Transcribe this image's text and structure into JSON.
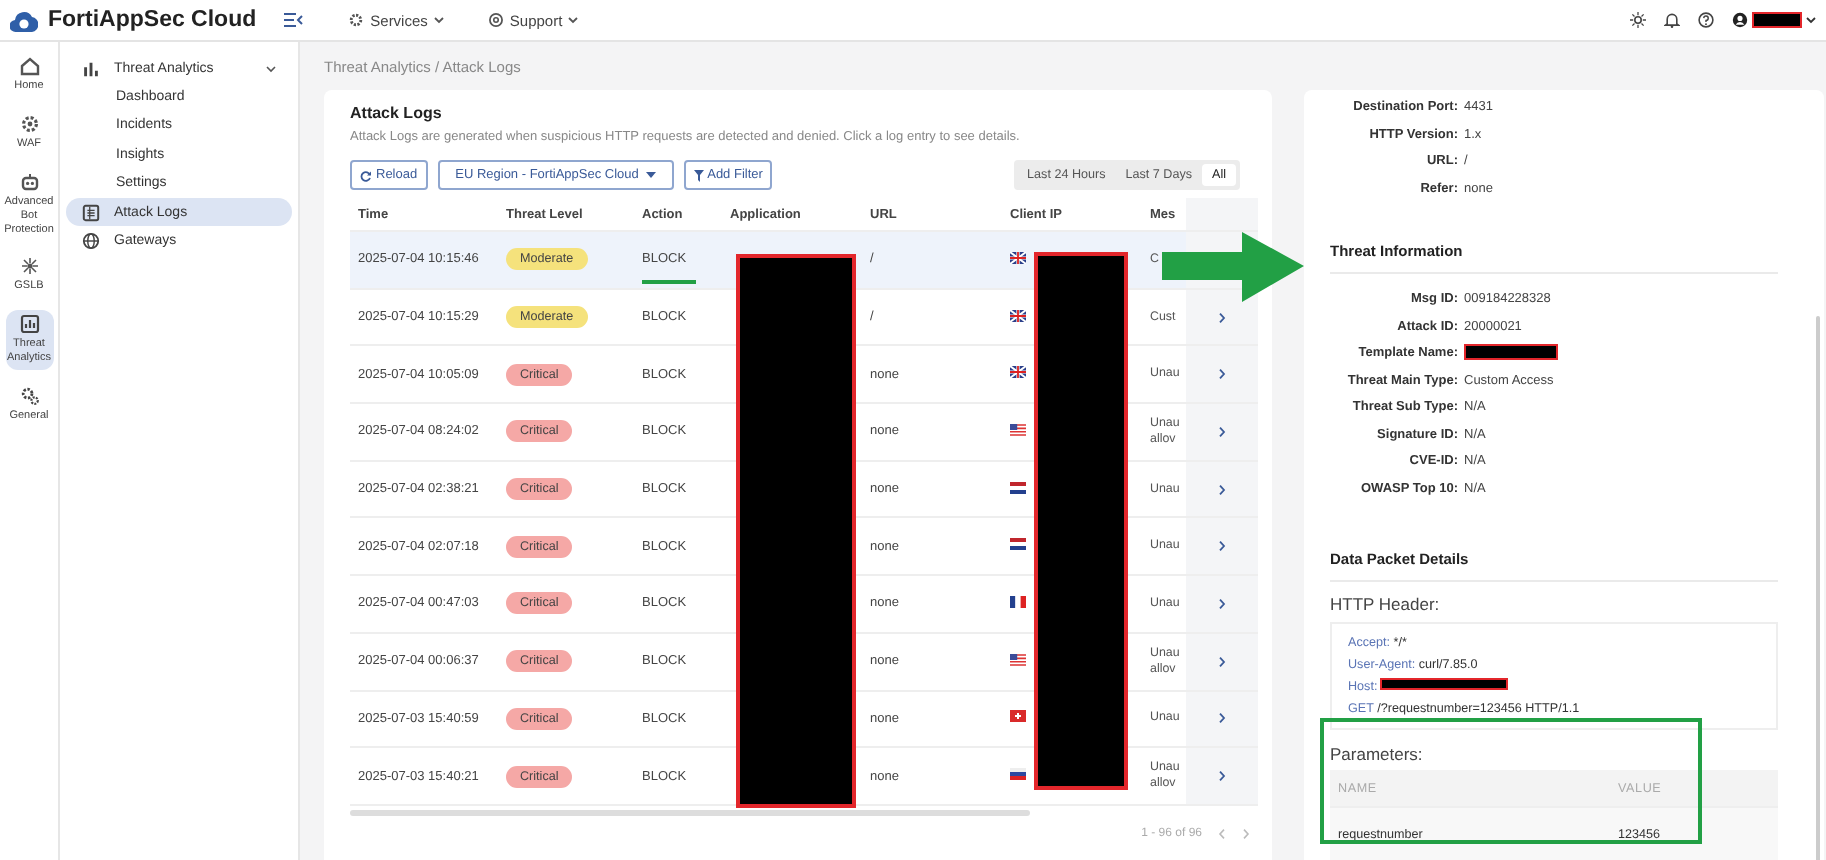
{
  "header": {
    "product": "FortiAppSec Cloud",
    "menus": [
      {
        "label": "Services"
      },
      {
        "label": "Support"
      }
    ]
  },
  "icon_rail": [
    {
      "label": "Home",
      "selected": false
    },
    {
      "label": "WAF",
      "selected": false
    },
    {
      "label": "Advanced Bot Protection",
      "selected": false
    },
    {
      "label": "GSLB",
      "selected": false
    },
    {
      "label": "Threat Analytics",
      "selected": true
    },
    {
      "label": "General",
      "selected": false
    }
  ],
  "nav": [
    {
      "label": "Threat Analytics",
      "selected": false,
      "expanded": true,
      "children": [
        {
          "label": "Dashboard",
          "selected": false
        },
        {
          "label": "Incidents",
          "selected": false
        },
        {
          "label": "Insights",
          "selected": false
        },
        {
          "label": "Settings",
          "selected": false
        }
      ]
    },
    {
      "label": "Attack Logs",
      "selected": true
    },
    {
      "label": "Gateways",
      "selected": false
    }
  ],
  "breadcrumb": "Threat Analytics / Attack Logs",
  "attack_logs": {
    "title": "Attack Logs",
    "description": "Attack Logs are generated when suspicious HTTP requests are detected and denied. Click a log entry to see details.",
    "toolbar": {
      "reload": "Reload",
      "region": "EU Region - FortiAppSec Cloud",
      "filter": "Add Filter"
    },
    "time_ranges": [
      {
        "label": "Last 24 Hours",
        "selected": false
      },
      {
        "label": "Last 7 Days",
        "selected": false
      },
      {
        "label": "All",
        "selected": true
      }
    ],
    "columns": [
      "Time",
      "Threat Level",
      "Action",
      "Application",
      "URL",
      "Client IP",
      "Mes"
    ],
    "rows": [
      {
        "time": "2025-07-04 10:15:46",
        "level": "Moderate",
        "color": "#f5e27c",
        "action": "BLOCK",
        "url": "/",
        "message": [
          "C"
        ],
        "selected": true
      },
      {
        "time": "2025-07-04 10:15:29",
        "level": "Moderate",
        "color": "#f5e27c",
        "action": "BLOCK",
        "url": "/",
        "message": [
          "Cust"
        ],
        "selected": false
      },
      {
        "time": "2025-07-04 10:05:09",
        "level": "Critical",
        "color": "#f5a8a6",
        "action": "BLOCK",
        "url": "none",
        "message": [
          "Unau"
        ],
        "selected": false
      },
      {
        "time": "2025-07-04 08:24:02",
        "level": "Critical",
        "color": "#f5a8a6",
        "action": "BLOCK",
        "url": "none",
        "message": [
          "Unau",
          "allov"
        ],
        "selected": false
      },
      {
        "time": "2025-07-04 02:38:21",
        "level": "Critical",
        "color": "#f5a8a6",
        "action": "BLOCK",
        "url": "none",
        "message": [
          "Unau"
        ],
        "selected": false
      },
      {
        "time": "2025-07-04 02:07:18",
        "level": "Critical",
        "color": "#f5a8a6",
        "action": "BLOCK",
        "url": "none",
        "message": [
          "Unau"
        ],
        "selected": false
      },
      {
        "time": "2025-07-04 00:47:03",
        "level": "Critical",
        "color": "#f5a8a6",
        "action": "BLOCK",
        "url": "none",
        "message": [
          "Unau"
        ],
        "selected": false
      },
      {
        "time": "2025-07-04 00:06:37",
        "level": "Critical",
        "color": "#f5a8a6",
        "action": "BLOCK",
        "url": "none",
        "message": [
          "Unau",
          "allov"
        ],
        "selected": false
      },
      {
        "time": "2025-07-03 15:40:59",
        "level": "Critical",
        "color": "#f5a8a6",
        "action": "BLOCK",
        "url": "none",
        "message": [
          "Unau"
        ],
        "selected": false
      },
      {
        "time": "2025-07-03 15:40:21",
        "level": "Critical",
        "color": "#f5a8a6",
        "action": "BLOCK",
        "url": "none",
        "message": [
          "Unau",
          "allov"
        ],
        "selected": false
      }
    ],
    "pagination": "1 - 96 of 96"
  },
  "details": {
    "request_fields": [
      {
        "label": "Destination Port:",
        "value": "4431"
      },
      {
        "label": "HTTP Version:",
        "value": "1.x"
      },
      {
        "label": "URL:",
        "value": "/"
      },
      {
        "label": "Refer:",
        "value": "none"
      }
    ],
    "threat_information": {
      "title": "Threat Information",
      "fields": [
        {
          "label": "Msg ID:",
          "value": "009184228328"
        },
        {
          "label": "Attack ID:",
          "value": "20000021"
        },
        {
          "label": "Template Name:",
          "redacted": true
        },
        {
          "label": "Threat Main Type:",
          "value": "Custom Access"
        },
        {
          "label": "Threat Sub Type:",
          "value": "N/A"
        },
        {
          "label": "Signature ID:",
          "value": "N/A"
        },
        {
          "label": "CVE-ID:",
          "value": "N/A"
        },
        {
          "label": "OWASP Top 10:",
          "value": "N/A"
        }
      ]
    },
    "data_packet": {
      "title": "Data Packet Details",
      "http_header_title": "HTTP Header:",
      "header_lines": [
        {
          "name": "Accept:",
          "value": "*/*"
        },
        {
          "name": "User-Agent:",
          "value": "curl/7.85.0"
        },
        {
          "name": "Host:",
          "redacted": true
        },
        {
          "name": "GET",
          "value": "/?requestnumber=123456 HTTP/1.1"
        }
      ],
      "parameters_title": "Parameters:",
      "parameter_columns": [
        "NAME",
        "VALUE"
      ],
      "parameters": [
        {
          "name": "requestnumber",
          "value": "123456"
        }
      ]
    }
  }
}
